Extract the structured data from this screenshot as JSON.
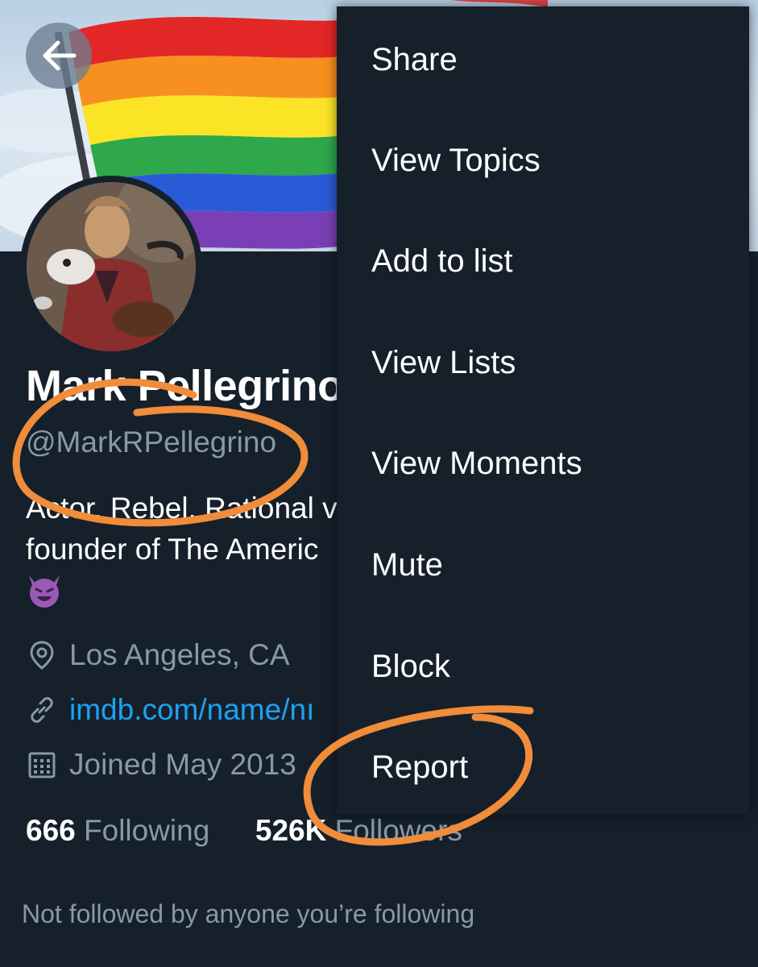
{
  "profile": {
    "name": "Mark Pellegrino",
    "handle": "@MarkRPellegrino",
    "bio_line1": "Actor. Rebel. Rational v",
    "bio_line2": "founder of The Americ",
    "bio_emoji": "smiling-devil-emoji",
    "location": "Los Angeles, CA",
    "website": "imdb.com/name/nı",
    "joined": "Joined May 2013",
    "following_count": "666",
    "following_label": "Following",
    "followers_count": "526K",
    "followers_label": "Followers",
    "not_followed": "Not followed by anyone you’re following"
  },
  "menu": {
    "items": [
      {
        "label": "Share"
      },
      {
        "label": "View Topics"
      },
      {
        "label": "Add to list"
      },
      {
        "label": "View Lists"
      },
      {
        "label": "View Moments"
      },
      {
        "label": "Mute"
      },
      {
        "label": "Block"
      },
      {
        "label": "Report"
      }
    ]
  },
  "icons": {
    "back": "arrow-left-icon",
    "location": "location-pin-icon",
    "link": "link-icon",
    "calendar": "calendar-icon"
  },
  "colors": {
    "background": "#15202b",
    "secondary_text": "#8899a6",
    "link": "#1da1f2",
    "annotation": "#f08c3a"
  }
}
